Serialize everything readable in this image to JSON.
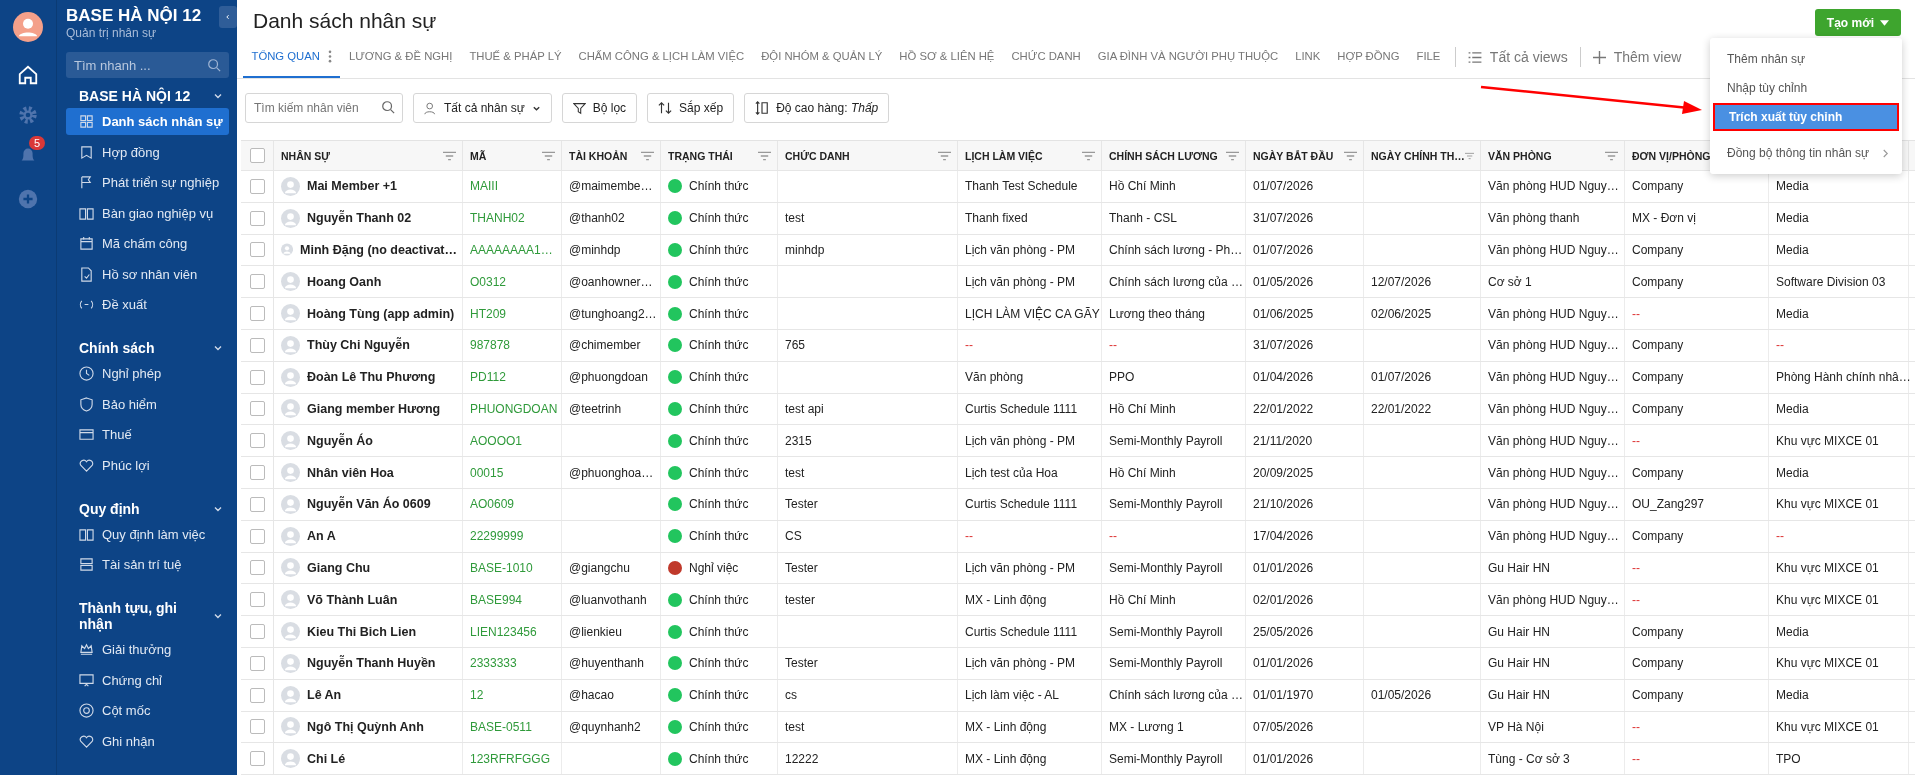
{
  "rail": {
    "notifications": "5"
  },
  "sidebar": {
    "org": "BASE HÀ NỘI 12",
    "role": "Quản trị nhân sự",
    "search": {
      "placeholder": "Tìm nhanh ..."
    },
    "sections": [
      {
        "title": "BASE HÀ NỘI 12",
        "expanded": true,
        "items": [
          {
            "label": "Danh sách nhân sự",
            "selected": true
          },
          {
            "label": "Hợp đồng",
            "selected": false
          },
          {
            "label": "Phát triển sự nghiệp",
            "selected": false
          },
          {
            "label": "Bàn giao nghiệp vụ",
            "selected": false
          },
          {
            "label": "Mã chấm công",
            "selected": false
          },
          {
            "label": "Hồ sơ nhân viên",
            "selected": false
          },
          {
            "label": "Đề xuất",
            "selected": false
          }
        ]
      },
      {
        "title": "Chính sách",
        "expanded": true,
        "items": [
          {
            "label": "Nghỉ phép",
            "selected": false
          },
          {
            "label": "Bảo hiểm",
            "selected": false
          },
          {
            "label": "Thuế",
            "selected": false
          },
          {
            "label": "Phúc lợi",
            "selected": false
          }
        ]
      },
      {
        "title": "Quy định",
        "expanded": true,
        "items": [
          {
            "label": "Quy định làm việc",
            "selected": false
          },
          {
            "label": "Tài sản trí tuệ",
            "selected": false
          }
        ]
      },
      {
        "title": "Thành tựu, ghi nhận",
        "expanded": true,
        "items": [
          {
            "label": "Giải thưởng",
            "selected": false
          },
          {
            "label": "Chứng chỉ",
            "selected": false
          },
          {
            "label": "Cột mốc",
            "selected": false
          },
          {
            "label": "Ghi nhận",
            "selected": false
          }
        ]
      }
    ]
  },
  "page": {
    "title": "Danh sách nhân sự",
    "create_button": "Tạo mới"
  },
  "tabs": [
    {
      "label": "TỔNG QUAN",
      "selected": true
    },
    {
      "label": "LƯƠNG & ĐỀ NGHỊ",
      "selected": false
    },
    {
      "label": "THUẾ & PHÁP LÝ",
      "selected": false
    },
    {
      "label": "CHẤM CÔNG & LỊCH LÀM VIỆC",
      "selected": false
    },
    {
      "label": "ĐỘI NHÓM & QUẢN LÝ",
      "selected": false
    },
    {
      "label": "HỒ SƠ & LIÊN HỆ",
      "selected": false
    },
    {
      "label": "CHỨC DANH",
      "selected": false
    },
    {
      "label": "GIA ĐÌNH VÀ NGƯỜI PHỤ THUỘC",
      "selected": false
    },
    {
      "label": "LINK",
      "selected": false
    },
    {
      "label": "HỢP ĐỒNG",
      "selected": false
    },
    {
      "label": "FILE",
      "selected": false
    }
  ],
  "view_actions": {
    "all_views": "Tất cả views",
    "add_view": "Thêm view"
  },
  "toolbar": {
    "search": {
      "placeholder": "Tìm kiếm nhân viên"
    },
    "scope": "Tất cả nhân sự",
    "filter": "Bộ lọc",
    "sort": "Sắp xếp",
    "row_height": "Độ cao hàng: *Thấp*"
  },
  "menu": [
    {
      "label": "Thêm nhân sự",
      "selected": false,
      "outlined": false,
      "submenu": false
    },
    {
      "label": "Nhập tùy chỉnh",
      "selected": false,
      "outlined": false,
      "submenu": false
    },
    {
      "label": "Trích xuất tùy chỉnh",
      "selected": true,
      "outlined": true,
      "submenu": false
    },
    {
      "label": "Đồng bộ thông tin nhân sự",
      "selected": false,
      "outlined": false,
      "submenu": true
    }
  ],
  "table": {
    "all_checked": false,
    "columns": [
      {
        "label": "NHÂN SỰ",
        "kind": "name"
      },
      {
        "label": "MÃ",
        "kind": "code"
      },
      {
        "label": "TÀI KHOẢN",
        "kind": "text"
      },
      {
        "label": "TRẠNG THÁI",
        "kind": "status"
      },
      {
        "label": "CHỨC DANH",
        "kind": "text"
      },
      {
        "label": "LỊCH LÀM VIỆC",
        "kind": "text"
      },
      {
        "label": "CHÍNH SÁCH LƯƠNG",
        "kind": "text"
      },
      {
        "label": "NGÀY BẮT ĐẦU",
        "kind": "text"
      },
      {
        "label": "NGÀY CHÍNH TH…",
        "kind": "text"
      },
      {
        "label": "VĂN PHÒNG",
        "kind": "text"
      },
      {
        "label": "ĐƠN VỊ/PHÒNG",
        "kind": "text"
      },
      {
        "kind": "text"
      }
    ],
    "rows": [
      {
        "checked": false,
        "cells": [
          "Mai Member +1",
          "MAIII",
          "@maimembe…",
          {
            "text": "Chính thức",
            "color": "#22c55e"
          },
          null,
          "Thanh Test Schedule",
          "Hồ Chí Minh",
          "01/07/2026",
          null,
          "Văn phòng HUD Nguy…",
          "Company",
          "Media"
        ]
      },
      {
        "checked": false,
        "cells": [
          "Nguyễn Thanh 02",
          "THANH02",
          "@thanh02",
          {
            "text": "Chính thức",
            "color": "#22c55e"
          },
          "test",
          "Thanh fixed",
          "Thanh - CSL",
          "31/07/2026",
          null,
          "Văn phòng thanh",
          "MX - Đơn vị",
          "Media"
        ]
      },
      {
        "checked": false,
        "cells": [
          "Minh Đặng (no deactivat…",
          "AAAAAAAA1…",
          "@minhdp",
          {
            "text": "Chính thức",
            "color": "#22c55e"
          },
          "minhdp",
          "Lịch văn phòng - PM",
          "Chính sách lương - Ph…",
          "01/07/2026",
          null,
          "Văn phòng HUD Nguy…",
          "Company",
          "Media"
        ]
      },
      {
        "checked": false,
        "cells": [
          "Hoang Oanh",
          "O0312",
          "@oanhowner…",
          {
            "text": "Chính thức",
            "color": "#22c55e"
          },
          null,
          "Lịch văn phòng - PM",
          "Chính sách lương của …",
          "01/05/2026",
          "12/07/2026",
          "Cơ sở 1",
          "Company",
          "Software Division 03"
        ]
      },
      {
        "checked": false,
        "cells": [
          "Hoàng Tùng (app admin)",
          "HT209",
          "@tunghoang2…",
          {
            "text": "Chính thức",
            "color": "#22c55e"
          },
          null,
          "LỊCH LÀM VIỆC CA GÃY",
          "Lương theo tháng",
          "01/06/2025",
          "02/06/2025",
          "Văn phòng HUD Nguy…",
          {
            "text": "--",
            "kind": "empty"
          },
          "Media"
        ]
      },
      {
        "checked": false,
        "cells": [
          "Thùy Chi Nguyễn",
          "987878",
          "@chimember",
          {
            "text": "Chính thức",
            "color": "#22c55e"
          },
          "765",
          {
            "text": "--",
            "kind": "empty"
          },
          {
            "text": "--",
            "kind": "empty"
          },
          "31/07/2026",
          null,
          "Văn phòng HUD Nguy…",
          "Company",
          {
            "text": "--",
            "kind": "empty"
          }
        ]
      },
      {
        "checked": false,
        "cells": [
          "Đoàn Lê Thu Phương",
          "PD112",
          "@phuongdoan",
          {
            "text": "Chính thức",
            "color": "#22c55e"
          },
          null,
          "Văn phòng",
          "PPO",
          "01/04/2026",
          "01/07/2026",
          "Văn phòng HUD Nguy…",
          "Company",
          "Phòng Hành chính nhâ…"
        ]
      },
      {
        "checked": false,
        "cells": [
          "Giang member Hương",
          "PHUONGDOAN",
          "@teetrinh",
          {
            "text": "Chính thức",
            "color": "#22c55e"
          },
          "test api",
          "Curtis Schedule 1111",
          "Hồ Chí Minh",
          "22/01/2022",
          "22/01/2022",
          "Văn phòng HUD Nguy…",
          "Company",
          "Media"
        ]
      },
      {
        "checked": false,
        "cells": [
          "Nguyễn Áo",
          "AOOOO1",
          null,
          {
            "text": "Chính thức",
            "color": "#22c55e"
          },
          "2315",
          "Lịch văn phòng - PM",
          "Semi-Monthly Payroll",
          "21/11/2020",
          null,
          "Văn phòng HUD Nguy…",
          {
            "text": "--",
            "kind": "empty"
          },
          "Khu vực MIXCE 01"
        ]
      },
      {
        "checked": false,
        "cells": [
          "Nhân viên Hoa",
          "00015",
          "@phuonghoa…",
          {
            "text": "Chính thức",
            "color": "#22c55e"
          },
          "test",
          "Lịch test của Hoa",
          "Hồ Chí Minh",
          "20/09/2025",
          null,
          "Văn phòng HUD Nguy…",
          "Company",
          "Media"
        ]
      },
      {
        "checked": false,
        "cells": [
          "Nguyễn Văn Áo 0609",
          "AO0609",
          null,
          {
            "text": "Chính thức",
            "color": "#22c55e"
          },
          "Tester",
          "Curtis Schedule 1111",
          "Semi-Monthly Payroll",
          "21/10/2026",
          null,
          "Văn phòng HUD Nguy…",
          "OU_Zang297",
          "Khu vực MIXCE 01"
        ]
      },
      {
        "checked": false,
        "cells": [
          "An A",
          "22299999",
          null,
          {
            "text": "Chính thức",
            "color": "#22c55e"
          },
          "CS",
          {
            "text": "--",
            "kind": "empty"
          },
          {
            "text": "--",
            "kind": "empty"
          },
          "17/04/2026",
          null,
          "Văn phòng HUD Nguy…",
          "Company",
          {
            "text": "--",
            "kind": "empty"
          }
        ]
      },
      {
        "checked": false,
        "cells": [
          "Giang Chu",
          "BASE-1010",
          "@giangchu",
          {
            "text": "Nghỉ việc",
            "color": "#c0392b"
          },
          "Tester",
          "Lịch văn phòng - PM",
          "Semi-Monthly Payroll",
          "01/01/2026",
          null,
          "Gu Hair HN",
          {
            "text": "--",
            "kind": "empty"
          },
          "Khu vực MIXCE 01"
        ]
      },
      {
        "checked": false,
        "cells": [
          "Võ Thành Luân",
          "BASE994",
          "@luanvothanh",
          {
            "text": "Chính thức",
            "color": "#22c55e"
          },
          "tester",
          "MX - Linh động",
          "Hồ Chí Minh",
          "02/01/2026",
          null,
          "Văn phòng HUD Nguy…",
          {
            "text": "--",
            "kind": "empty"
          },
          "Khu vực MIXCE 01"
        ]
      },
      {
        "checked": false,
        "cells": [
          "Kieu Thi Bich Lien",
          "LIEN123456",
          "@lienkieu",
          {
            "text": "Chính thức",
            "color": "#22c55e"
          },
          null,
          "Curtis Schedule 1111",
          "Semi-Monthly Payroll",
          "25/05/2026",
          null,
          "Gu Hair HN",
          "Company",
          "Media"
        ]
      },
      {
        "checked": false,
        "cells": [
          "Nguyễn Thanh Huyền",
          "2333333",
          "@huyenthanh",
          {
            "text": "Chính thức",
            "color": "#22c55e"
          },
          "Tester",
          "Lịch văn phòng - PM",
          "Semi-Monthly Payroll",
          "01/01/2026",
          null,
          "Gu Hair HN",
          "Company",
          "Khu vực MIXCE 01"
        ]
      },
      {
        "checked": false,
        "cells": [
          "Lê An",
          "12",
          "@hacao",
          {
            "text": "Chính thức",
            "color": "#22c55e"
          },
          "cs",
          "Lịch làm việc - AL",
          "Chính sách lương của …",
          "01/01/1970",
          "01/05/2026",
          "Gu Hair HN",
          "Company",
          "Media"
        ]
      },
      {
        "checked": false,
        "cells": [
          "Ngô Thị Quỳnh Anh",
          "BASE-0511",
          "@quynhanh2",
          {
            "text": "Chính thức",
            "color": "#22c55e"
          },
          "test",
          "MX - Linh động",
          "MX - Lương 1",
          "07/05/2026",
          null,
          "VP Hà Nội",
          {
            "text": "--",
            "kind": "empty"
          },
          "Khu vực MIXCE 01"
        ]
      },
      {
        "checked": false,
        "cells": [
          "Chi Lé",
          "123RFRFGGG",
          null,
          {
            "text": "Chính thức",
            "color": "#22c55e"
          },
          "12222",
          "MX - Linh động",
          "Semi-Monthly Payroll",
          "01/01/2026",
          null,
          "Tùng - Cơ sở 3",
          {
            "text": "--",
            "kind": "empty"
          },
          "TPO"
        ]
      }
    ]
  }
}
